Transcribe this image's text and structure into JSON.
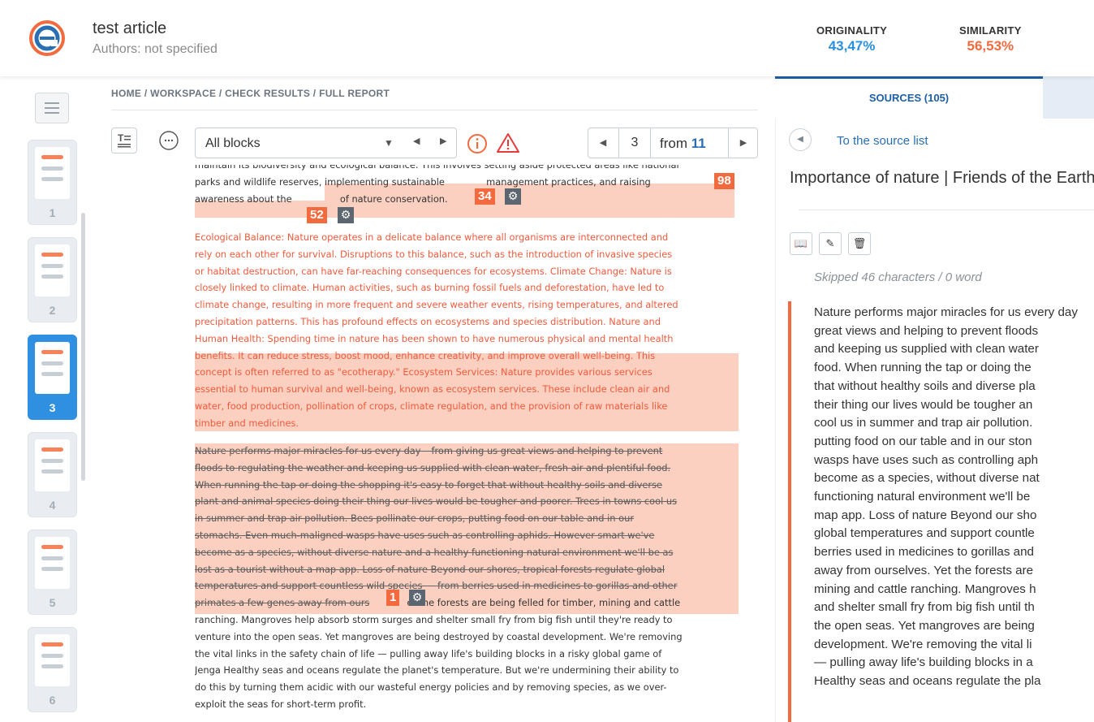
{
  "header": {
    "title": "test article",
    "authors": "Authors: not specified",
    "originality_label": "ORIGINALITY",
    "originality_value": "43,47%",
    "similarity_label": "SIMILARITY",
    "similarity_value": "56,53%",
    "colors": {
      "originality": "#2a8fdc",
      "similarity": "#f26a3e",
      "brand": "#1e5fa6"
    }
  },
  "breadcrumb": "HOME / WORKSPACE / CHECK RESULTS / FULL REPORT",
  "toolbar": {
    "filter_value": "All blocks",
    "page_current": "3",
    "page_from": "from",
    "page_total": "11"
  },
  "thumbnails": [
    {
      "num": "1",
      "active": false
    },
    {
      "num": "2",
      "active": false
    },
    {
      "num": "3",
      "active": true
    },
    {
      "num": "4",
      "active": false
    },
    {
      "num": "5",
      "active": false
    },
    {
      "num": "6",
      "active": false
    }
  ],
  "document": {
    "p1_line1": "maintain its biodiversity and ecological balance. This involves setting aside protected areas like national",
    "p1_line2a": "parks and wildlife reserves",
    "p1_line2b": ", implementing sustainable ",
    "p1_line2c": " management practices, and raising",
    "p1_line3a": "awareness about the ",
    "p1_line3b": " of nature conservation.",
    "p2": [
      "Ecological Balance: Nature operates in a delicate balance where all organisms are interconnected and",
      "rely on each other for survival. Disruptions to this balance, such as the introduction of invasive species",
      "or habitat destruction, can have far-reaching consequences for ecosystems. Climate Change: Nature is",
      "closely linked to climate. Human activities, such as burning fossil fuels and deforestation, have led to",
      "climate change, resulting in more frequent and severe weather events, rising temperatures, and altered",
      "precipitation patterns. This has profound effects on ecosystems and species distribution. Nature and",
      "Human Health: Spending time in nature has been shown to have numerous physical and mental health",
      "benefits. It can reduce stress, boost mood, enhance creativity, and improve overall well-being. This",
      "concept is often referred to as \"ecotherapy.\" Ecosystem Services: Nature provides various services",
      "essential to human survival and well-being, known as ecosystem services. These include clean air and",
      "water, food production, pollination of crops, climate regulation, and the provision of raw materials like",
      "timber and medicines."
    ],
    "p3": [
      "Nature performs major miracles for us every day – from giving us great views and helping to prevent",
      "floods to regulating the weather and keeping us supplied with clean water, fresh air and plentiful food.",
      "When running the tap or doing the shopping it's easy to forget that without healthy soils and diverse",
      "plant and animal species doing their thing our lives would be tougher and poorer. Trees in towns cool us",
      "in summer and trap air pollution. Bees pollinate our crops, putting food on our table and in our",
      "stomachs. Even much-maligned wasps have uses such as controlling aphids. However smart we've",
      "become as a species, without diverse nature and a healthy functioning natural environment we'll be as",
      "lost as a tourist without a map app. Loss of nature Beyond our shores, tropical forests regulate global",
      "temperatures and support countless wild species — from berries used in medicines to gorillas and other",
      "primates a few genes away from ours",
      "et the forests are being felled for timber, mining and cattle",
      "ranching. Mangroves help absorb storm surges and shelter small fry from big fish until they're ready to",
      "venture into the open seas. Yet mangroves are being destroyed by coastal development. We're removing",
      "the vital links in the safety chain of life — pulling away life's building blocks in a risky global game of",
      "Jenga Healthy seas and oceans regulate the planet's temperature. But we're undermining their ability to",
      "do this by turning them acidic with our wasteful energy policies and by removing species, as we over-",
      "exploit the seas for short-term profit."
    ],
    "badges": [
      "98",
      "34",
      "52",
      "1"
    ]
  },
  "right_panel": {
    "tab_label": "SOURCES (105)",
    "back_label": "To the source list",
    "source_title": "Importance of nature | Friends of the Earth",
    "skipped": "Skipped 46 characters / 0 word",
    "source_text": "Nature performs major miracles for us every day\ngreat views and helping to prevent floods\nand keeping us supplied with clean water\nfood. When running the tap or doing the\nthat without healthy soils and diverse pla\ntheir thing our lives would be tougher an\ncool us in summer and trap air pollution.\nputting food on our table and in our ston\nwasps have uses such as controlling aph\nbecome as a species, without diverse nat\nfunctioning natural environment we'll be\nmap app. Loss of nature Beyond our sho\nglobal temperatures and support countle\nberries used in medicines to gorillas and\naway from ourselves. Yet the forests are\nmining and cattle ranching. Mangroves h\nand shelter small fry from big fish until th\nthe open seas. Yet mangroves are being\ndevelopment. We're removing the vital li\n— pulling away life's building blocks in a\nHealthy seas and oceans regulate the pla"
  }
}
